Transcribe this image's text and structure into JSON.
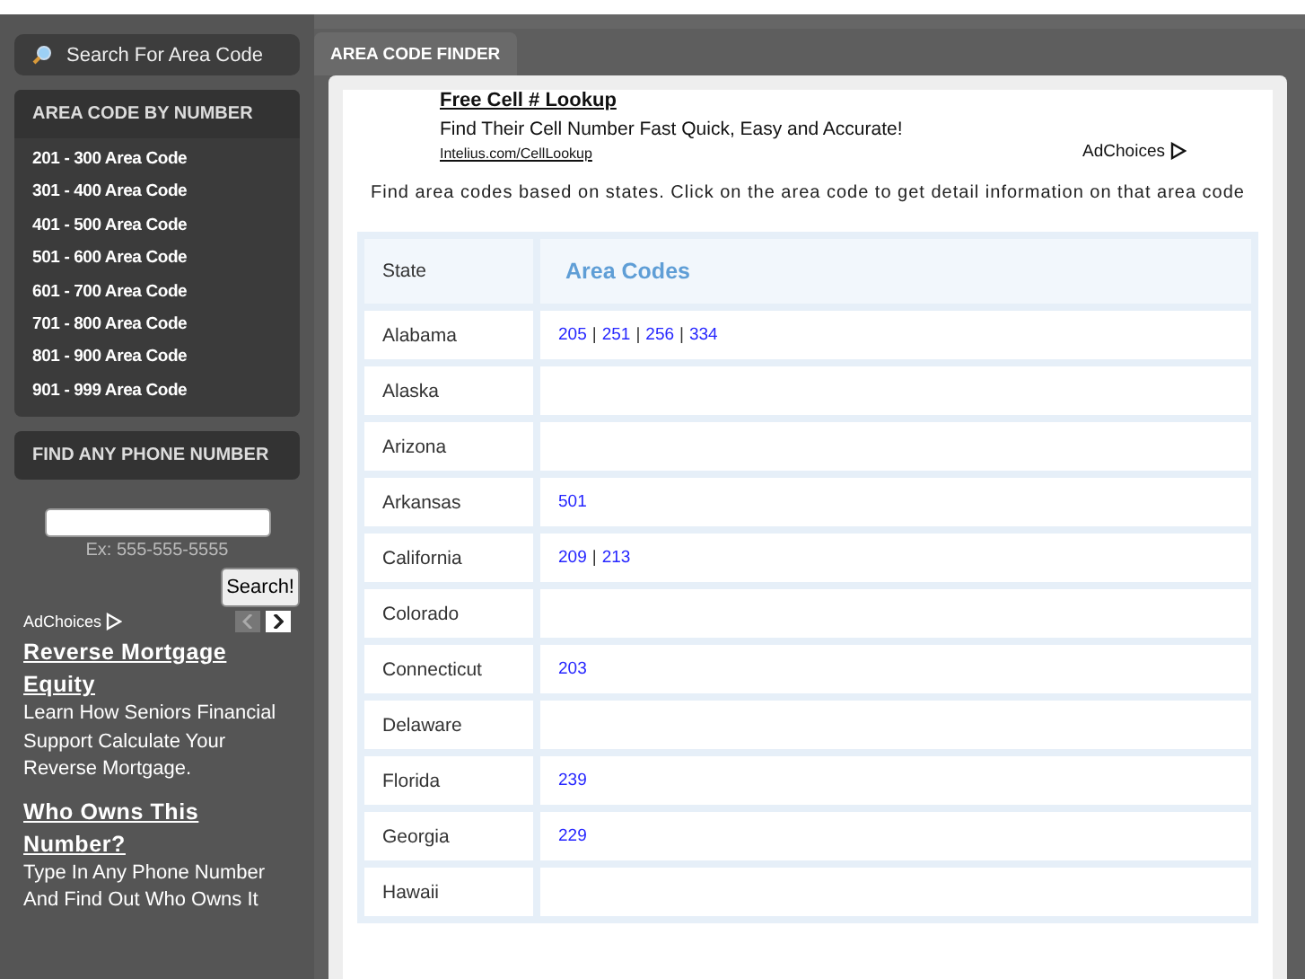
{
  "sidebar": {
    "search_label": "Search For Area Code",
    "by_number": {
      "title": "AREA CODE BY NUMBER",
      "items": [
        "201 - 300 Area Code",
        "301 - 400 Area Code",
        "401 - 500 Area Code",
        "501 - 600 Area Code",
        "601 - 700 Area Code",
        "701 - 800 Area Code",
        "801 - 900 Area Code",
        "901 - 999 Area Code"
      ]
    },
    "phone": {
      "title": "FIND ANY PHONE NUMBER",
      "hint": "Ex: 555-555-5555",
      "button": "Search!"
    },
    "ad": {
      "adchoices": "AdChoices",
      "items": [
        {
          "title": "Reverse Mortgage Equity",
          "text": "Learn How Seniors Financial Support Calculate Your Reverse Mortgage."
        },
        {
          "title": "Who Owns This Number?",
          "text": "Type In Any Phone Number And Find Out Who Owns It"
        }
      ]
    }
  },
  "tabs": [
    {
      "label": "AREA CODE FINDER",
      "selected": true
    }
  ],
  "ad": {
    "title": "Free Cell # Lookup",
    "text": "Find Their Cell Number Fast Quick, Easy and Accurate!",
    "url": "Intelius.com/CellLookup",
    "adchoices": "AdChoices"
  },
  "intro": "Find area codes based on states. Click on the area code to get detail information on that area code",
  "table": {
    "columns": [
      "State",
      "Area Codes"
    ],
    "separator": "|",
    "rows": [
      {
        "state": "Alabama",
        "codes": [
          "205",
          "251",
          "256",
          "334"
        ]
      },
      {
        "state": "Alaska",
        "codes": []
      },
      {
        "state": "Arizona",
        "codes": []
      },
      {
        "state": "Arkansas",
        "codes": [
          "501"
        ]
      },
      {
        "state": "California",
        "codes": [
          "209",
          "213"
        ]
      },
      {
        "state": "Colorado",
        "codes": []
      },
      {
        "state": "Connecticut",
        "codes": [
          "203"
        ]
      },
      {
        "state": "Delaware",
        "codes": []
      },
      {
        "state": "Florida",
        "codes": [
          "239"
        ]
      },
      {
        "state": "Georgia",
        "codes": [
          "229"
        ]
      },
      {
        "state": "Hawaii",
        "codes": []
      }
    ]
  }
}
